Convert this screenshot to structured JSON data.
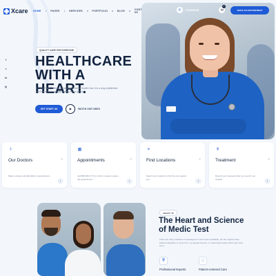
{
  "header": {
    "logo_text": "Xcare",
    "nav": [
      {
        "label": "HOME",
        "active": true
      },
      {
        "label": "PAGES",
        "active": false
      },
      {
        "label": "SERVICES",
        "active": false
      },
      {
        "label": "PORTFOLIO",
        "active": false
      },
      {
        "label": "BLOG",
        "active": false
      },
      {
        "label": "CONTACT US",
        "active": false
      }
    ],
    "phone": "+123456-89",
    "cart_count": "0",
    "appointment_label": "MAKE AN APPOINTMENT"
  },
  "social": [
    "f",
    "×",
    "in",
    "◎"
  ],
  "hero": {
    "tagline": "QUALITY CARE FOR EVERYONE",
    "title_line1": "HEALTHCARE",
    "title_line2": "WITH A HEART.",
    "description": "X-Care Place Of Medical Hospital Center & Health Care It is a long established fact that a reader simply dummy text is typical.",
    "primary_button": "GET START US",
    "video_label": "WATCH OUR VIDEO"
  },
  "cards": [
    {
      "icon": "doctor-icon",
      "glyph": "⚕",
      "title": "Our Doctors",
      "description": "Make a simple and affordable or appointment."
    },
    {
      "icon": "calendar-icon",
      "glyph": "▦",
      "title": "Appointments",
      "description": "Call 888-800-1774 or click to request a same day appointment."
    },
    {
      "icon": "location-icon",
      "glyph": "⌖",
      "title": "Find Locations",
      "description": "Search our locations to find the one nearest you."
    },
    {
      "icon": "treatment-icon",
      "glyph": "☤",
      "title": "Treatment",
      "description": "Record your treatment after you send to our website."
    }
  ],
  "about": {
    "tag": "ABOUT US",
    "title_line1": "The Heart and Science",
    "title_line2": "of Medic Test",
    "description": "There are many variations of passages of Lorem Ipsum available, but the majority have suffered alteration in some form, by injected humour, or randomised words which don't look even.",
    "features": [
      {
        "icon": "shield-icon",
        "label": "Professional Experts"
      },
      {
        "icon": "care-icon",
        "label": "Patient-centered Care"
      }
    ]
  },
  "colors": {
    "accent": "#1f5bd6",
    "dark": "#12233f",
    "background": "#f3f7fc"
  }
}
